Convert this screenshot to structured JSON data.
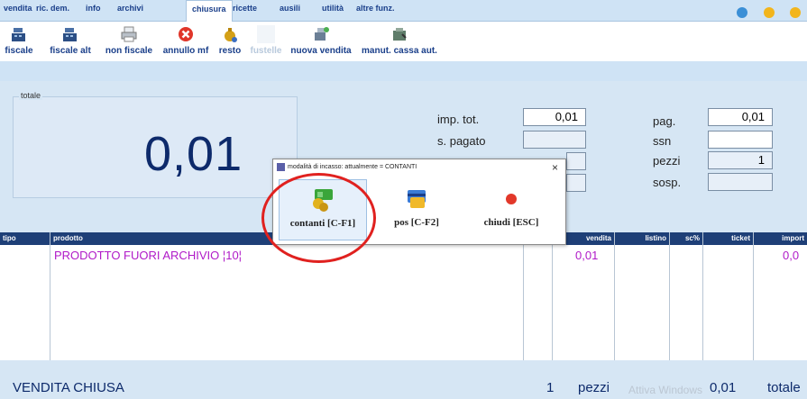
{
  "menu": {
    "tabs": [
      "vendita",
      "ric. dem.",
      "info",
      "archivi",
      "chiusura",
      "ricette",
      "ausili",
      "utilità",
      "altre funz."
    ],
    "active_tab": "chiusura"
  },
  "toolbar": {
    "fiscale": "fiscale",
    "fiscale_alt": "fiscale alt",
    "non_fiscale": "non fiscale",
    "annullo_mf": "annullo mf",
    "resto": "resto",
    "fustelle": "fustelle",
    "nuova_vendita": "nuova vendita",
    "manut_cassa": "manut. cassa aut."
  },
  "total": {
    "label": "totale",
    "value": "0,01"
  },
  "fields": {
    "imp_tot_label": "imp. tot.",
    "imp_tot_value": "0,01",
    "s_pagato_label": "s. pagato",
    "pag_label": "pag.",
    "pag_value": "0,01",
    "ssn_label": "ssn",
    "pezzi_label": "pezzi",
    "pezzi_value": "1",
    "sosp_label": "sosp."
  },
  "table": {
    "headers": {
      "tipo": "tipo",
      "prodotto": "prodotto",
      "vendita": "vendita",
      "listino": "listino",
      "sc": "sc%",
      "ticket": "ticket",
      "importo": "import"
    },
    "rows": [
      {
        "prodotto": "PRODOTTO FUORI ARCHIVIO ¦10¦",
        "vendita": "0,01",
        "importo": "0,0"
      }
    ]
  },
  "footer": {
    "status": "VENDITA CHIUSA",
    "count": "1",
    "pezzi": "pezzi",
    "watermark": "Attiva Windows",
    "total": "0,01",
    "totale": "totale"
  },
  "dialog": {
    "title": "modalità di incasso: attualmente = CONTANTI",
    "close": "×",
    "contanti": "contanti [C-F1]",
    "pos": "pos [C-F2]",
    "chiudi": "chiudi [ESC]"
  },
  "colors": {
    "accent": "#1a3f8a",
    "header_bg": "#1e3f77",
    "product_text": "#b01ac8",
    "highlight_circle": "#e0211f"
  }
}
